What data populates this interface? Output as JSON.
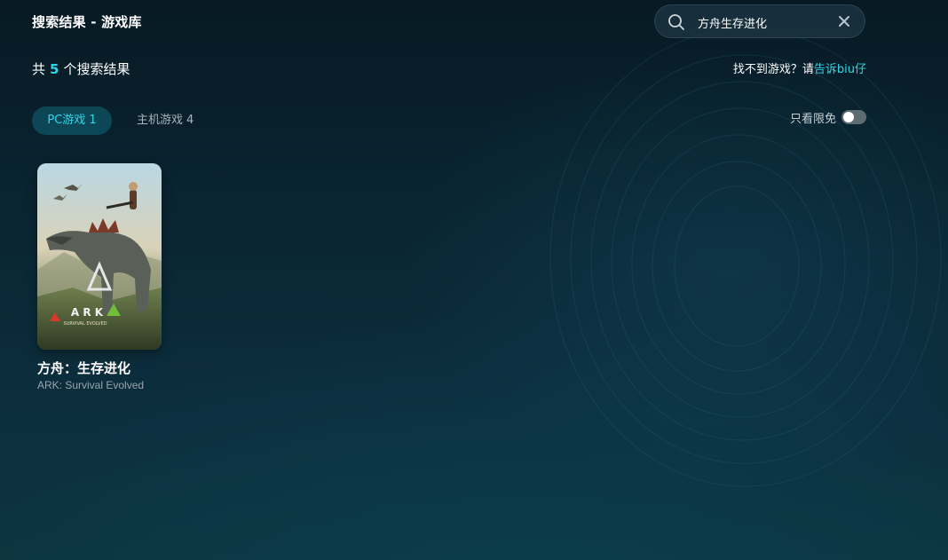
{
  "header": {
    "title": "搜索结果 - 游戏库"
  },
  "search": {
    "value": "方舟生存进化"
  },
  "summary": {
    "prefix": "共",
    "count": "5",
    "suffix": "个搜索结果"
  },
  "feedback": {
    "text": "找不到游戏？请",
    "link": "告诉biu仔"
  },
  "tabs": [
    {
      "label": "PC游戏",
      "count": "1",
      "active": true
    },
    {
      "label": "主机游戏",
      "count": "4",
      "active": false
    }
  ],
  "filter": {
    "label": "只看限免",
    "enabled": false
  },
  "games": [
    {
      "title": "方舟：生存进化",
      "subtitle": "ARK: Survival Evolved",
      "cover_logo": "A R K",
      "cover_tagline": "SURVIVAL EVOLVED"
    }
  ],
  "colors": {
    "accent": "#2fd6e8",
    "background": "#0a2533"
  },
  "icons": {
    "search": "search-icon",
    "clear": "close-icon"
  }
}
